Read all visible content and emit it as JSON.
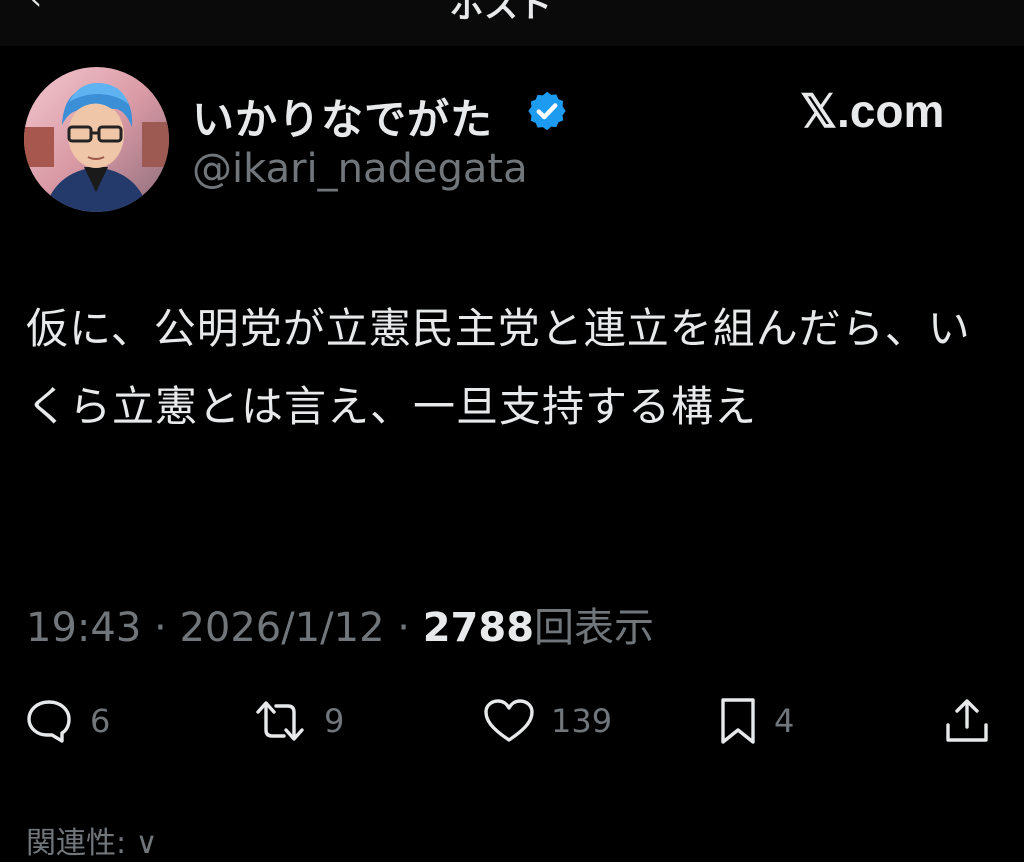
{
  "header": {
    "back_glyph": "‹",
    "title": "ポスト"
  },
  "author": {
    "display_name": "いかりなでがた",
    "handle": "@ikari_nadegata",
    "verified_icon": "verified-badge-icon",
    "verified_color": "#1d9bf0"
  },
  "watermark": "𝕏.com",
  "post": {
    "text": "仮に、公明党が立憲民主党と連立を組んだら、いくら立憲とは言え、一旦支持する構え"
  },
  "meta": {
    "time": "19:43",
    "separator": " · ",
    "date": "2026/1/12",
    "views_count": "2788",
    "views_label": "回表示"
  },
  "actions": {
    "reply_count": "6",
    "repost_count": "9",
    "like_count": "139",
    "bookmark_count": "4"
  },
  "related_label": "関連性: ∨",
  "colors": {
    "background": "#000000",
    "text": "#e7e9ea",
    "muted": "#71767b",
    "accent": "#1d9bf0"
  }
}
